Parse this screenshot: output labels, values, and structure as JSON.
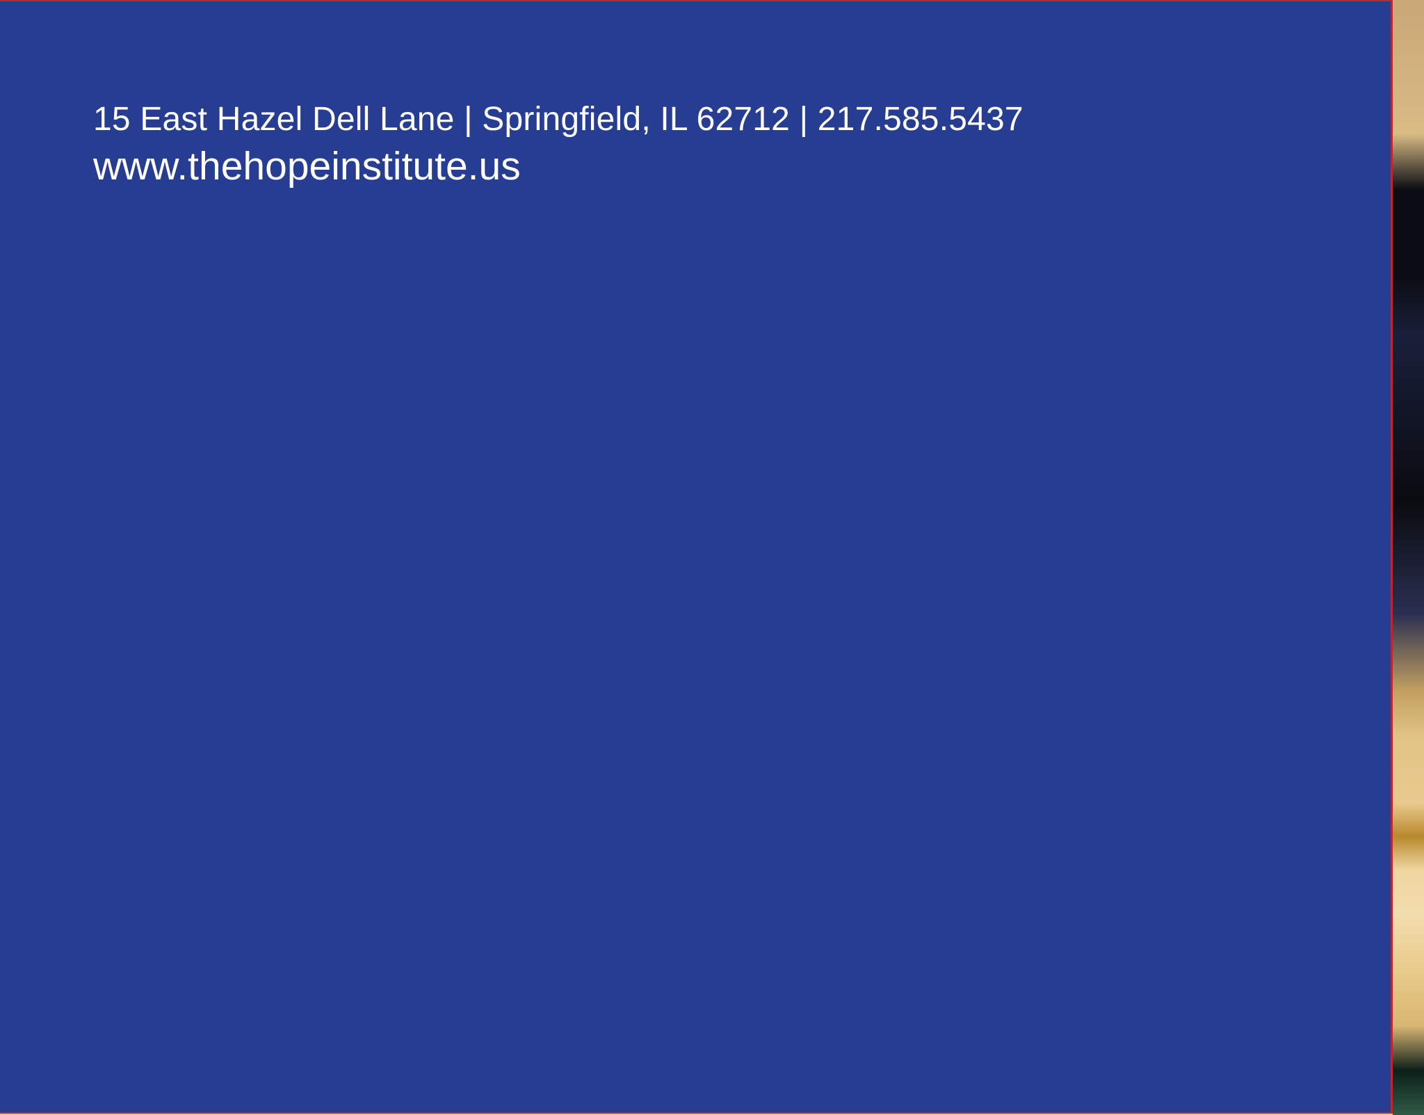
{
  "contact": {
    "address_line": "15 East Hazel Dell Lane | Springfield, IL 62712 | 217.585.5437",
    "website": "www.thehopeinstitute.us"
  },
  "colors": {
    "panel_blue": "#263d91",
    "border_red": "#b8282f",
    "text": "#ffffff"
  }
}
